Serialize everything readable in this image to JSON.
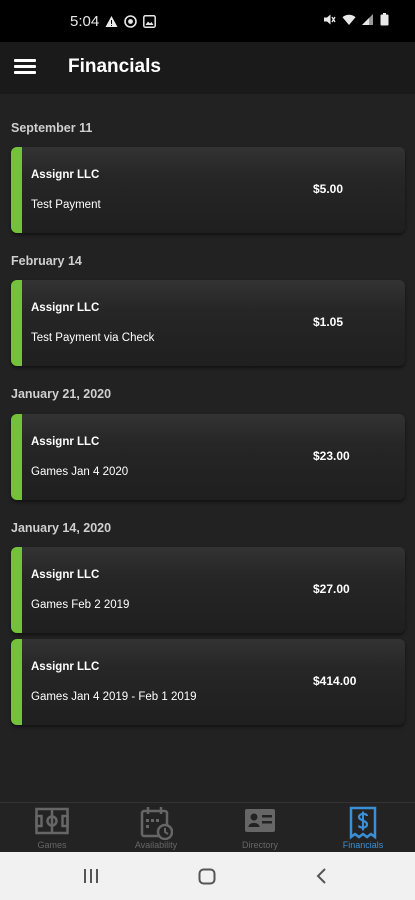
{
  "status_bar": {
    "time": "5:04",
    "left_icons": [
      "warning-icon",
      "target-icon",
      "image-icon"
    ],
    "right_icons": [
      "mute-icon",
      "wifi-icon",
      "signal-icon",
      "battery-icon"
    ]
  },
  "app_bar": {
    "title": "Financials"
  },
  "groups": [
    {
      "date": "September 11",
      "items": [
        {
          "payer": "Assignr LLC",
          "description": "Test Payment",
          "amount": "$5.00"
        }
      ]
    },
    {
      "date": "February 14",
      "items": [
        {
          "payer": "Assignr LLC",
          "description": "Test Payment via Check",
          "amount": "$1.05"
        }
      ]
    },
    {
      "date": "January 21, 2020",
      "items": [
        {
          "payer": "Assignr LLC",
          "description": "Games Jan 4 2020",
          "amount": "$23.00"
        }
      ]
    },
    {
      "date": "January 14, 2020",
      "items": [
        {
          "payer": "Assignr LLC",
          "description": "Games Feb 2 2019",
          "amount": "$27.00"
        },
        {
          "payer": "Assignr LLC",
          "description": "Games Jan 4 2019 - Feb 1 2019",
          "amount": "$414.00"
        }
      ]
    }
  ],
  "bottom_nav": {
    "items": [
      {
        "label": "Games",
        "icon": "field-icon",
        "active": false
      },
      {
        "label": "Availability",
        "icon": "calendar-clock-icon",
        "active": false
      },
      {
        "label": "Directory",
        "icon": "contact-card-icon",
        "active": false
      },
      {
        "label": "Financials",
        "icon": "receipt-dollar-icon",
        "active": true
      }
    ]
  },
  "colors": {
    "accent": "#75c13a",
    "active_tab": "#3a8fd6",
    "background": "#222222"
  }
}
